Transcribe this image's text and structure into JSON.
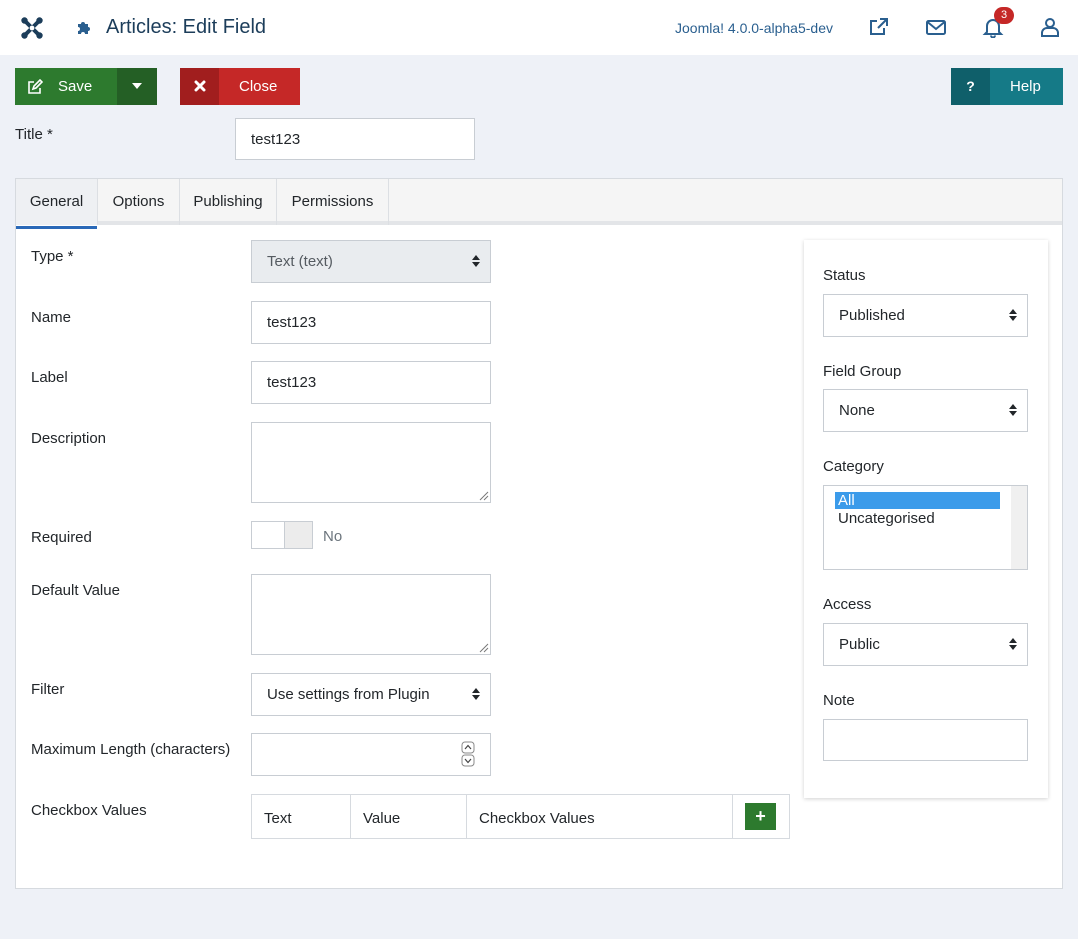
{
  "header": {
    "title": "Articles: Edit Field",
    "version": "Joomla! 4.0.0-alpha5-dev",
    "notification_count": "3",
    "icons": [
      "joomla-logo-icon",
      "puzzle-icon",
      "external-link-icon",
      "envelope-icon",
      "bell-icon",
      "user-icon"
    ]
  },
  "toolbar": {
    "save_label": "Save",
    "close_label": "Close",
    "help_label": "Help",
    "help_icon_glyph": "?"
  },
  "title_field": {
    "label": "Title *",
    "value": "test123"
  },
  "tabs": [
    {
      "label": "General",
      "active": true
    },
    {
      "label": "Options",
      "active": false
    },
    {
      "label": "Publishing",
      "active": false
    },
    {
      "label": "Permissions",
      "active": false
    }
  ],
  "general": {
    "type": {
      "label": "Type *",
      "value": "Text (text)"
    },
    "name": {
      "label": "Name",
      "value": "test123"
    },
    "label": {
      "label": "Label",
      "value": "test123"
    },
    "description": {
      "label": "Description",
      "value": ""
    },
    "required": {
      "label": "Required",
      "value": "No"
    },
    "default_value": {
      "label": "Default Value",
      "value": ""
    },
    "filter": {
      "label": "Filter",
      "value": "Use settings from Plugin"
    },
    "max_length": {
      "label": "Maximum Length (characters)",
      "value": ""
    },
    "checkbox_values": {
      "label": "Checkbox Values",
      "columns": [
        "Text",
        "Value",
        "Checkbox Values"
      ],
      "add_glyph": "+"
    }
  },
  "sidebar": {
    "status": {
      "label": "Status",
      "value": "Published"
    },
    "field_group": {
      "label": "Field Group",
      "value": "None"
    },
    "category": {
      "label": "Category",
      "options": [
        "All",
        "Uncategorised"
      ],
      "selected": "All"
    },
    "access": {
      "label": "Access",
      "value": "Public"
    },
    "note": {
      "label": "Note",
      "value": ""
    }
  },
  "colors": {
    "save_green": "#2d7a2e",
    "close_red": "#c52827",
    "help_teal": "#157a87",
    "header_blue": "#1c3d5a",
    "selection_blue": "#3b9bea"
  }
}
